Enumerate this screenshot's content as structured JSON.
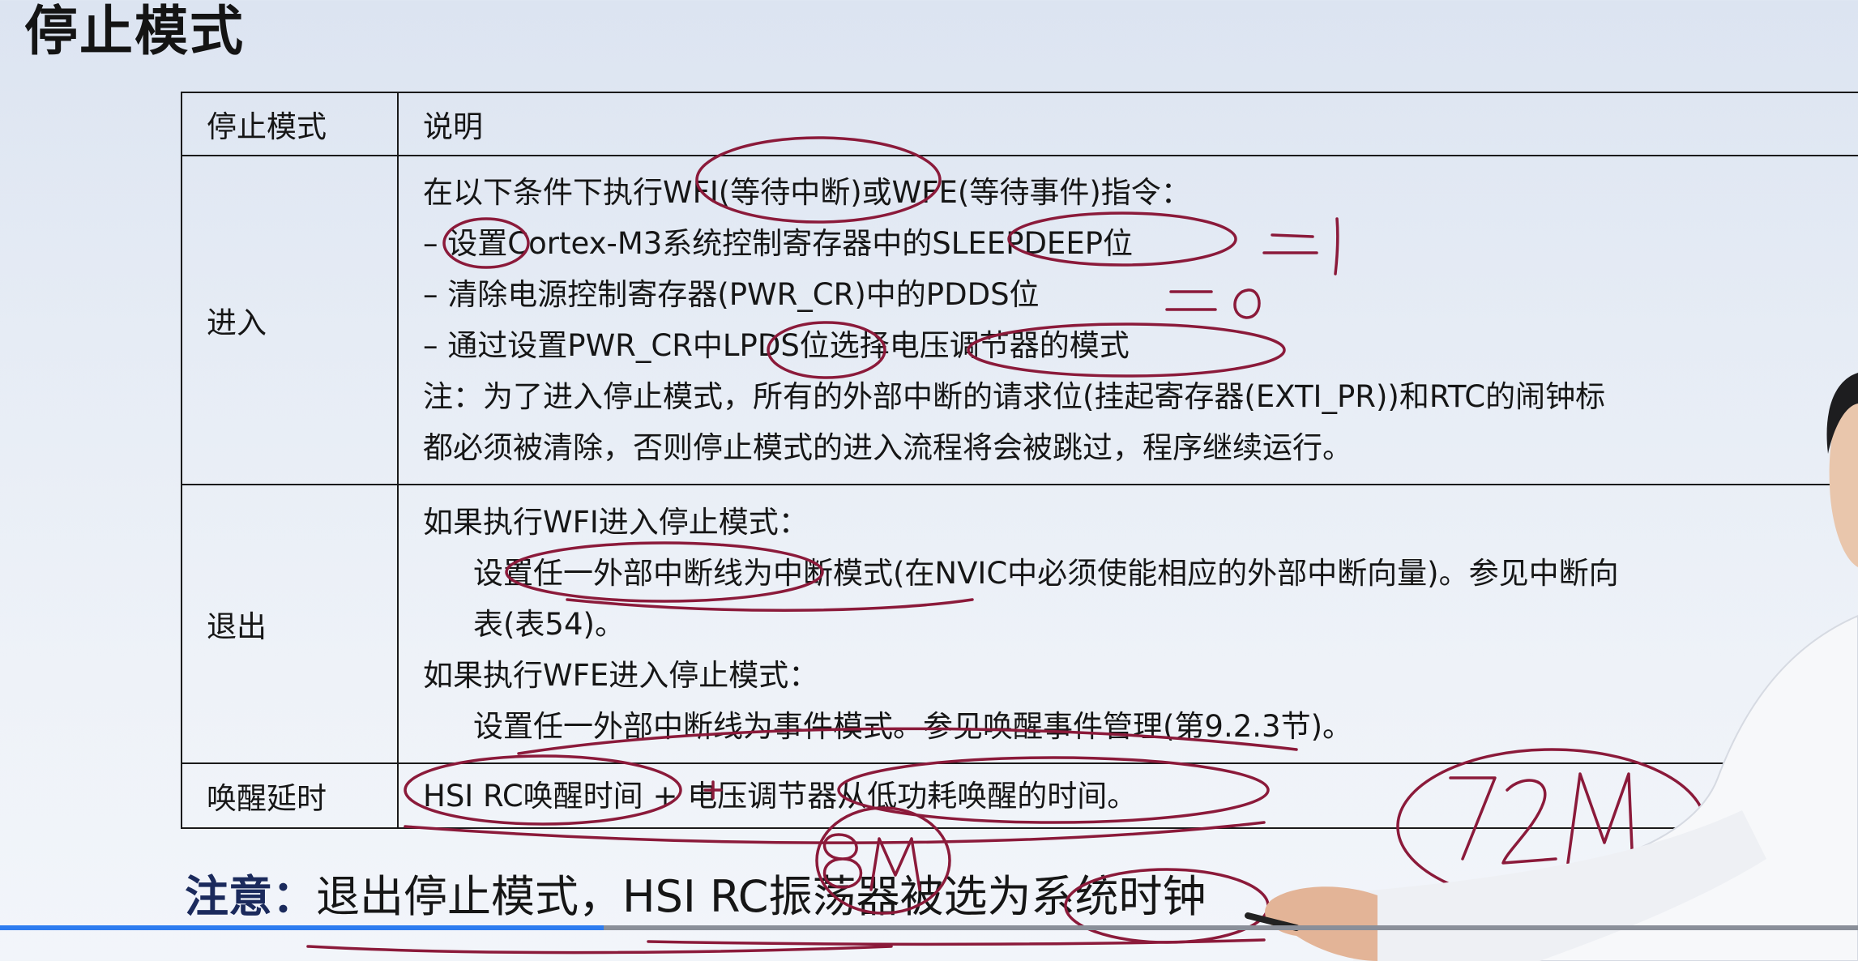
{
  "slide": {
    "title": "停止模式"
  },
  "table": {
    "headers": [
      "停止模式",
      "说明"
    ],
    "enter": {
      "label": "进入",
      "lines": [
        "在以下条件下执行WFI(等待中断)或WFE(等待事件)指令：",
        "– 设置Cortex-M3系统控制寄存器中的SLEEPDEEP位",
        "– 清除电源控制寄存器(PWR_CR)中的PDDS位",
        "– 通过设置PWR_CR中LPDS位选择电压调节器的模式",
        "注：为了进入停止模式，所有的外部中断的请求位(挂起寄存器(EXTI_PR))和RTC的闹钟标",
        "都必须被清除，否则停止模式的进入流程将会被跳过，程序继续运行。"
      ]
    },
    "exit": {
      "label": "退出",
      "lines": [
        "如果执行WFI进入停止模式：",
        "设置任一外部中断线为中断模式(在NVIC中必须使能相应的外部中断向量)。参见中断向",
        "表(表54)。",
        "如果执行WFE进入停止模式：",
        "设置任一外部中断线为事件模式。参见唤醒事件管理(第9.2.3节)。"
      ]
    },
    "wake": {
      "label": "唤醒延时",
      "text": "HSI RC唤醒时间 + 电压调节器从低功耗唤醒的时间。"
    }
  },
  "note": {
    "label": "注意：",
    "text": "退出停止模式，HSI RC振荡器被选为系统时钟"
  },
  "annotations": {
    "sleepdeep_value": "= 1",
    "pdds_value": "= 0",
    "hsi_freq": "8M",
    "sys_freq": "72M"
  },
  "video": {
    "progress": 0.325,
    "played_color": "#2d7cf0",
    "track_color": "#8a8f99"
  },
  "colors": {
    "ink": "#8b1a3a",
    "background": "#e6ecf5"
  }
}
